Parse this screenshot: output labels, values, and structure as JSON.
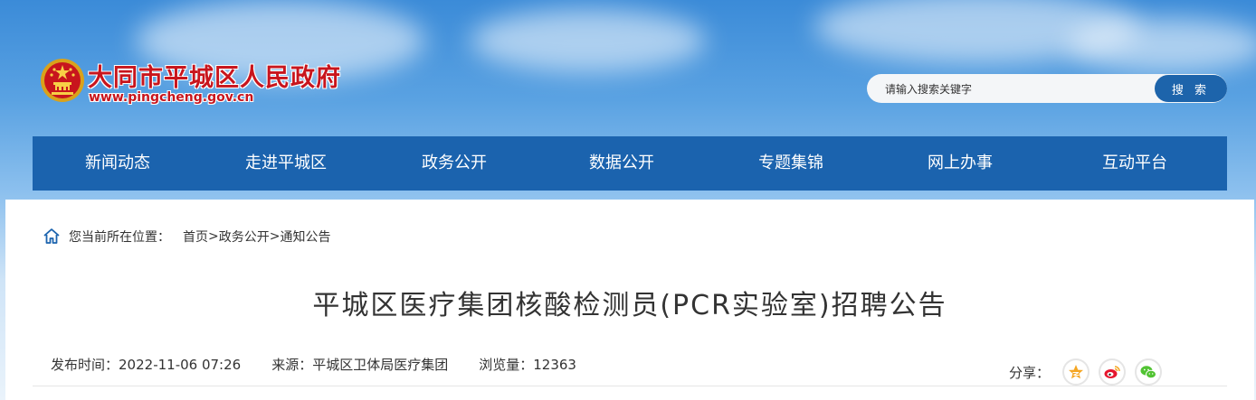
{
  "header": {
    "site_title": "大同市平城区人民政府",
    "site_url": "www.pingcheng.gov.cn",
    "emblem_icon": "national-emblem-icon",
    "search": {
      "placeholder": "请输入搜索关键字",
      "button_label": "搜 索"
    }
  },
  "nav": {
    "items": [
      {
        "label": "新闻动态"
      },
      {
        "label": "走进平城区"
      },
      {
        "label": "政务公开"
      },
      {
        "label": "数据公开"
      },
      {
        "label": "专题集锦"
      },
      {
        "label": "网上办事"
      },
      {
        "label": "互动平台"
      }
    ]
  },
  "breadcrumb": {
    "prefix": "您当前所在位置：",
    "items": [
      "首页",
      "政务公开",
      "通知公告"
    ],
    "separator": ">"
  },
  "article": {
    "title": "平城区医疗集团核酸检测员(PCR实验室)招聘公告",
    "publish_label": "发布时间：",
    "publish_time": "2022-11-06 07:26",
    "source_label": "来源：",
    "source": "平城区卫体局医疗集团",
    "views_label": "浏览量：",
    "views": "12363"
  },
  "share": {
    "label": "分享：",
    "buttons": [
      "qzone-icon",
      "weibo-icon",
      "wechat-icon"
    ]
  },
  "colors": {
    "brand_red": "#c8151d",
    "nav_blue": "#1b63ae",
    "search_button": "#1d64ab",
    "qzone": "#f5a623",
    "weibo": "#e6162d",
    "wechat": "#51c332"
  }
}
